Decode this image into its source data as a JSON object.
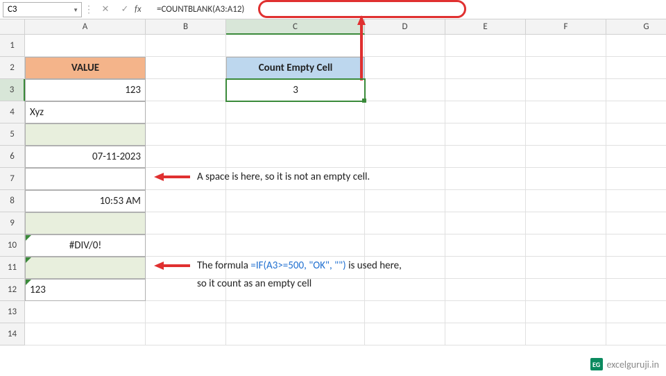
{
  "name_box": "C3",
  "formula_bar": "=COUNTBLANK(A3:A12)",
  "fx_label": "fx",
  "columns": [
    "A",
    "B",
    "C",
    "D",
    "E",
    "F",
    "G"
  ],
  "rows": [
    "1",
    "2",
    "3",
    "4",
    "5",
    "6",
    "7",
    "8",
    "9",
    "10",
    "11",
    "12",
    "13",
    "14"
  ],
  "headers": {
    "A2": "VALUE",
    "C2": "Count Empty Cell"
  },
  "data": {
    "A3": "123",
    "A4": "Xyz",
    "A5": "",
    "A6": "07-11-2023",
    "A7": "",
    "A8": "10:53 AM",
    "A9": "",
    "A10": "#DIV/0!",
    "A11": "",
    "A12": "123",
    "C3": "3"
  },
  "annotations": {
    "row7": "A space is here, so it is not an empty cell.",
    "row11_pre": "The formula ",
    "row11_formula": "=IF(A3>=500, \"OK\", \"\")",
    "row11_post": " is used here,",
    "row11_line2": "so it count as an empty cell"
  },
  "watermark": {
    "logo": "EG",
    "text": "excelguruji.in"
  },
  "chart_data": {
    "type": "table",
    "title": "Excel COUNTBLANK example",
    "formula": "=COUNTBLANK(A3:A12)",
    "result": 3,
    "column_header": "VALUE",
    "range": "A3:A12",
    "values": [
      "123",
      "Xyz",
      "",
      "07-11-2023",
      " ",
      "10:53 AM",
      "",
      "#DIV/0!",
      "",
      "123"
    ],
    "notes": {
      "A7": "contains a space character, not counted as blank",
      "A11": "formula =IF(A3>=500,\"OK\",\"\") returns empty string, counted as blank"
    },
    "result_header": "Count Empty Cell"
  }
}
